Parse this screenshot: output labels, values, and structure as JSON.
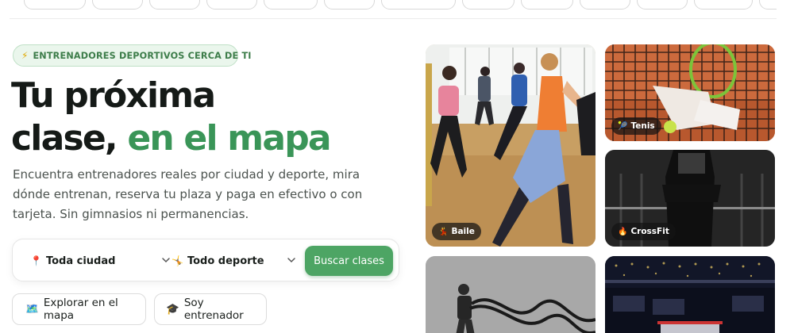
{
  "top_chips": [
    "",
    "",
    "",
    "",
    "",
    "",
    "",
    "",
    "",
    "",
    "",
    "",
    ""
  ],
  "badge": {
    "icon": "lightning-icon",
    "text": "ENTRENADORES DEPORTIVOS CERCA DE TI"
  },
  "hero": {
    "title_part1_line1": "Tu próxima",
    "title_part1_line2": "clase,",
    "title_accent": "en el mapa",
    "description": "Encuentra entrenadores reales por ciudad y deporte, mira dónde entrenan, reserva tu plaza y paga en efectivo o con tarjeta. Sin gimnasios ni permanencias."
  },
  "search": {
    "city": {
      "icon": "pin-icon",
      "value": "Toda ciudad"
    },
    "sport": {
      "icon": "sport-icon",
      "value": "Todo deporte"
    },
    "button": "Buscar clases"
  },
  "actions": {
    "map": {
      "icon": "map-icon",
      "label": "Explorar en el mapa"
    },
    "coach": {
      "icon": "graduation-cap-icon",
      "label": "Soy entrenador"
    }
  },
  "tiles": [
    {
      "label": "Baile",
      "icon": "dancer-icon"
    },
    {
      "label": "Tenis",
      "icon": "tennis-ball-icon"
    },
    {
      "label": "CrossFit",
      "icon": "fire-icon"
    },
    {
      "label": "",
      "icon": ""
    },
    {
      "label": "",
      "icon": ""
    }
  ],
  "colors": {
    "accent": "#3a9558",
    "button": "#4da564",
    "badge_bg": "#eaf6ec"
  }
}
